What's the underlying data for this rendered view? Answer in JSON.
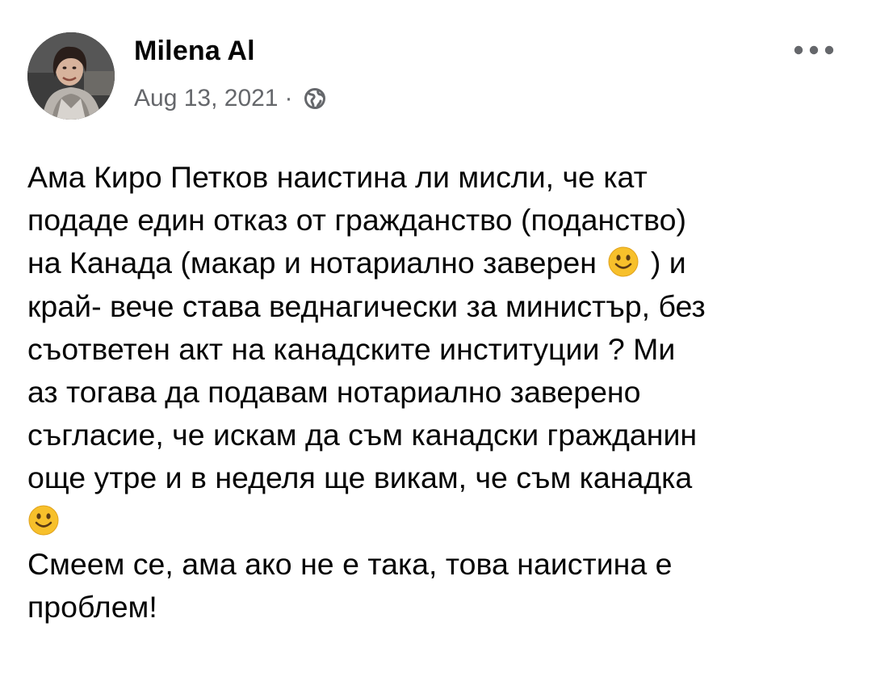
{
  "post": {
    "author": {
      "name": "Milena Al",
      "avatar": "author-avatar-photo"
    },
    "meta": {
      "date": "Aug 13, 2021",
      "separator": "·",
      "privacy_icon": "globe-icon"
    },
    "more_icon": "more-options-icon",
    "body": {
      "paragraph1": {
        "line1": "Ама Киро Петков наистина ли мисли, че кат",
        "line2": "подаде един отказ от гражданство (поданство)",
        "line3a": "на Канада (макар и нотариално заверен",
        "line3b": ") и",
        "line4": "край- вече става веднагически за министър, без",
        "line5": "съответен акт на канадските институции ?  Ми",
        "line6": "аз тогава да подавам нотариално заверено",
        "line7": "съгласие, че искам да съм канадски гражданин",
        "line8": "още утре и в неделя ще викам, че съм канадка"
      },
      "paragraph2": {
        "line1": "Смеем се, ама ако не е така, това наистина е",
        "line2": "проблем!"
      },
      "emoji_icon": "smiling-face-emoji"
    }
  },
  "colors": {
    "text_primary": "#050505",
    "text_secondary": "#65676b",
    "background": "#ffffff",
    "emoji_face": "#f7c02b"
  }
}
